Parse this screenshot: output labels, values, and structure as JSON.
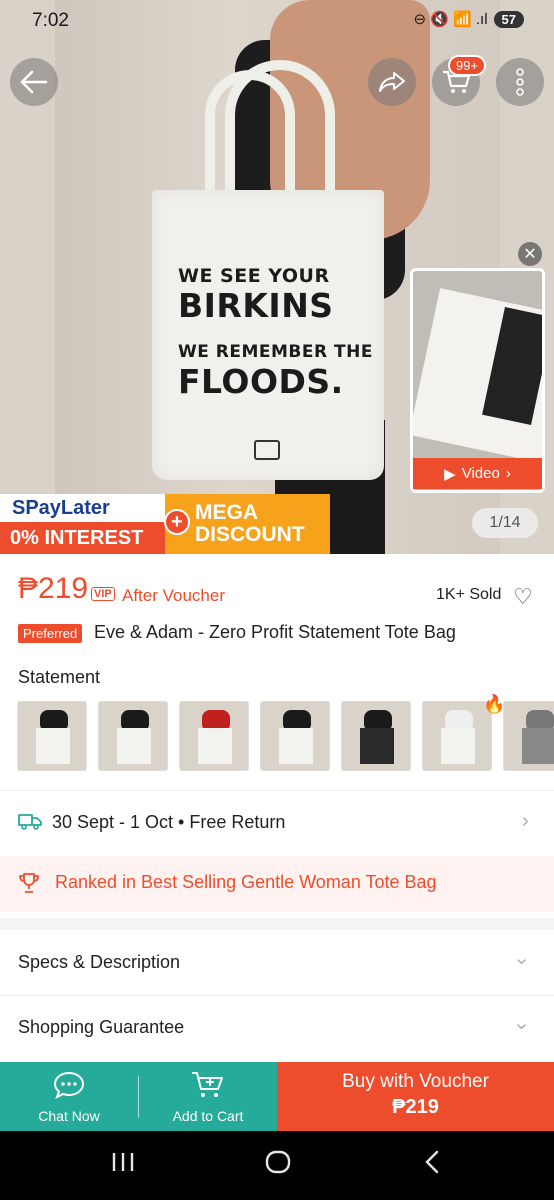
{
  "status_bar": {
    "time": "7:02",
    "battery": "57",
    "signal_icons": "⊖ 🔇 📶 .ıl"
  },
  "top_bar": {
    "back_icon": "arrow-left-icon",
    "share_icon": "share-icon",
    "cart_icon": "cart-icon",
    "cart_badge": "99+",
    "more_icon": "more-vertical-icon"
  },
  "hero": {
    "bag_lines": [
      "WE SEE YOUR",
      "BIRKINS",
      "WE REMEMBER THE",
      "FLOODS."
    ],
    "image_counter": "1/14",
    "video_label": "Video",
    "spaylater_label": "SPayLater",
    "interest_label": "0% INTEREST",
    "mega_line1": "MEGA",
    "mega_line2": "DISCOUNT"
  },
  "product": {
    "price": "₱219",
    "vip_label": "VIP",
    "after_voucher": "After Voucher",
    "sold": "1K+ Sold",
    "preferred_label": "Preferred",
    "title": "Eve & Adam - Zero Profit Statement Tote Bag",
    "variant_heading": "Statement",
    "variants": [
      {
        "name": "birkins-floods",
        "shirt": "#1a1a1a"
      },
      {
        "name": "wealth-honesty",
        "shirt": "#1a1a1a"
      },
      {
        "name": "our-taxes-red",
        "shirt": "#c0201e"
      },
      {
        "name": "reason",
        "shirt": "#1a1a1a"
      },
      {
        "name": "floods-black",
        "shirt": "#1a1a1a"
      },
      {
        "name": "taxes-lifestyle",
        "shirt": "#ffffff"
      },
      {
        "name": "taxes-lifestyle-grey",
        "shirt": "#777777"
      }
    ]
  },
  "delivery": {
    "text": "30 Sept - 1 Oct • Free Return"
  },
  "ranked": {
    "text": "Ranked in Best Selling Gentle Woman Tote Bag"
  },
  "sections": {
    "specs": "Specs & Description",
    "guarantee": "Shopping Guarantee"
  },
  "bottom_bar": {
    "chat_label": "Chat Now",
    "cart_label": "Add to Cart",
    "buy_label": "Buy with Voucher",
    "buy_price": "₱219"
  },
  "colors": {
    "accent": "#ee4d2d",
    "teal": "#26aa99"
  }
}
